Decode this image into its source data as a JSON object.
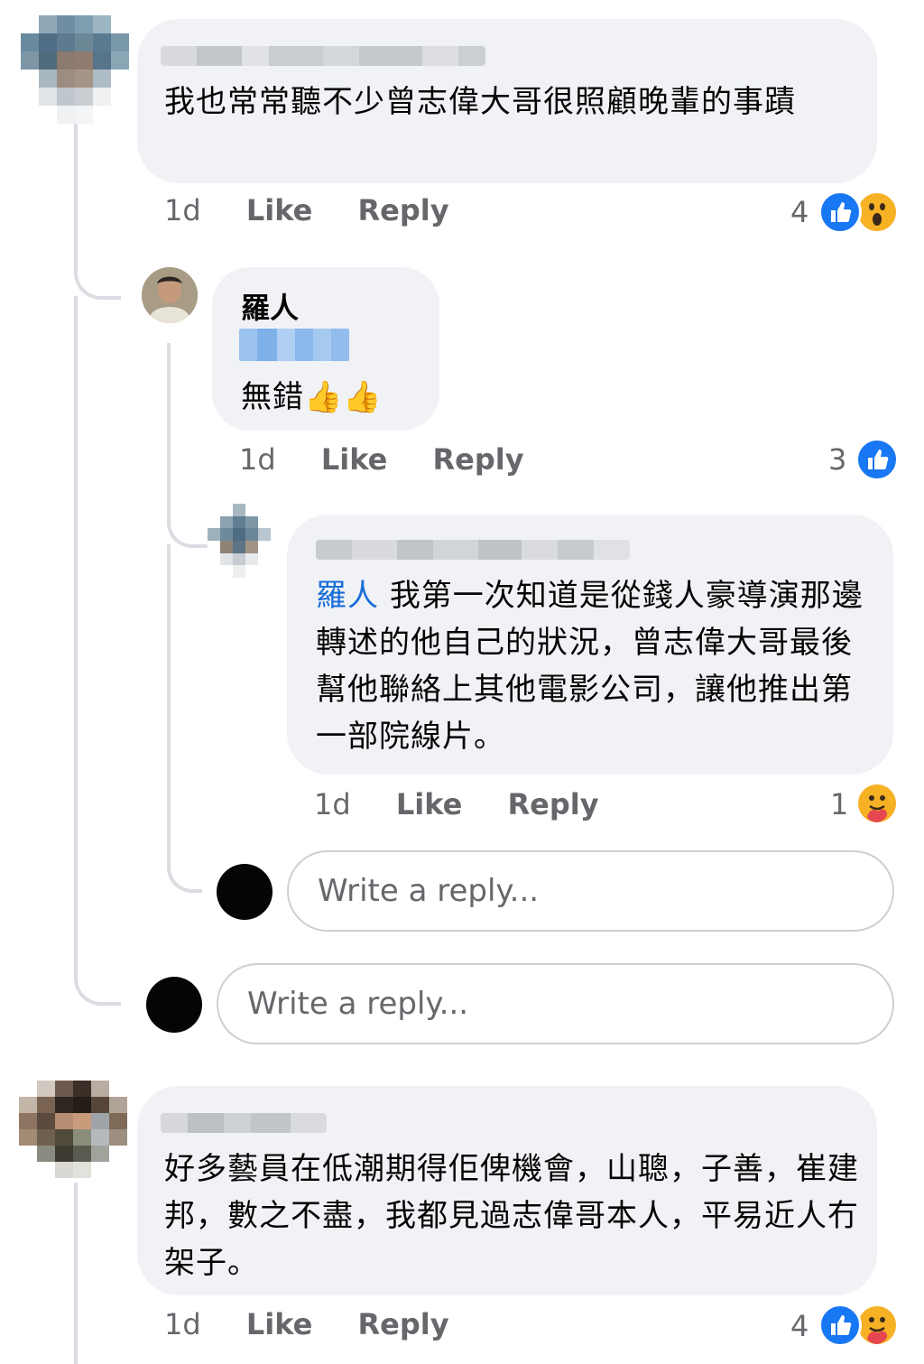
{
  "comments": [
    {
      "text": "我也常常聽不少曾志偉大哥很照顧晚輩的事蹟",
      "time": "1d",
      "like_label": "Like",
      "reply_label": "Reply",
      "reaction_count": "4",
      "reactions": [
        "like-icon",
        "wow-icon"
      ]
    },
    {
      "author": "羅人",
      "text": "無錯",
      "emoji": "👍👍",
      "time": "1d",
      "like_label": "Like",
      "reply_label": "Reply",
      "reaction_count": "3",
      "reactions": [
        "like-icon"
      ]
    },
    {
      "mention": "羅人",
      "text": "我第一次知道是從錢人豪導演那邊轉述的他自己的狀況，曾志偉大哥最後幫他聯絡上其他電影公司，讓他推出第一部院線片。",
      "time": "1d",
      "like_label": "Like",
      "reply_label": "Reply",
      "reaction_count": "1",
      "reactions": [
        "care-icon"
      ]
    },
    {
      "text": "好多藝員在低潮期得佢俾機會，山聰，子善，崔建邦，數之不盡，我都見過志偉哥本人，平易近人冇架子。",
      "time": "1d",
      "like_label": "Like",
      "reply_label": "Reply",
      "reaction_count": "4",
      "reactions": [
        "like-icon",
        "care-icon"
      ]
    }
  ],
  "reply_inputs": [
    {
      "placeholder": "Write a reply..."
    },
    {
      "placeholder": "Write a reply..."
    }
  ],
  "colors": {
    "bubble": "#f0f2f5",
    "meta_text": "#65676b",
    "mention": "#1a6ed8",
    "like_blue": "#1877f2"
  }
}
